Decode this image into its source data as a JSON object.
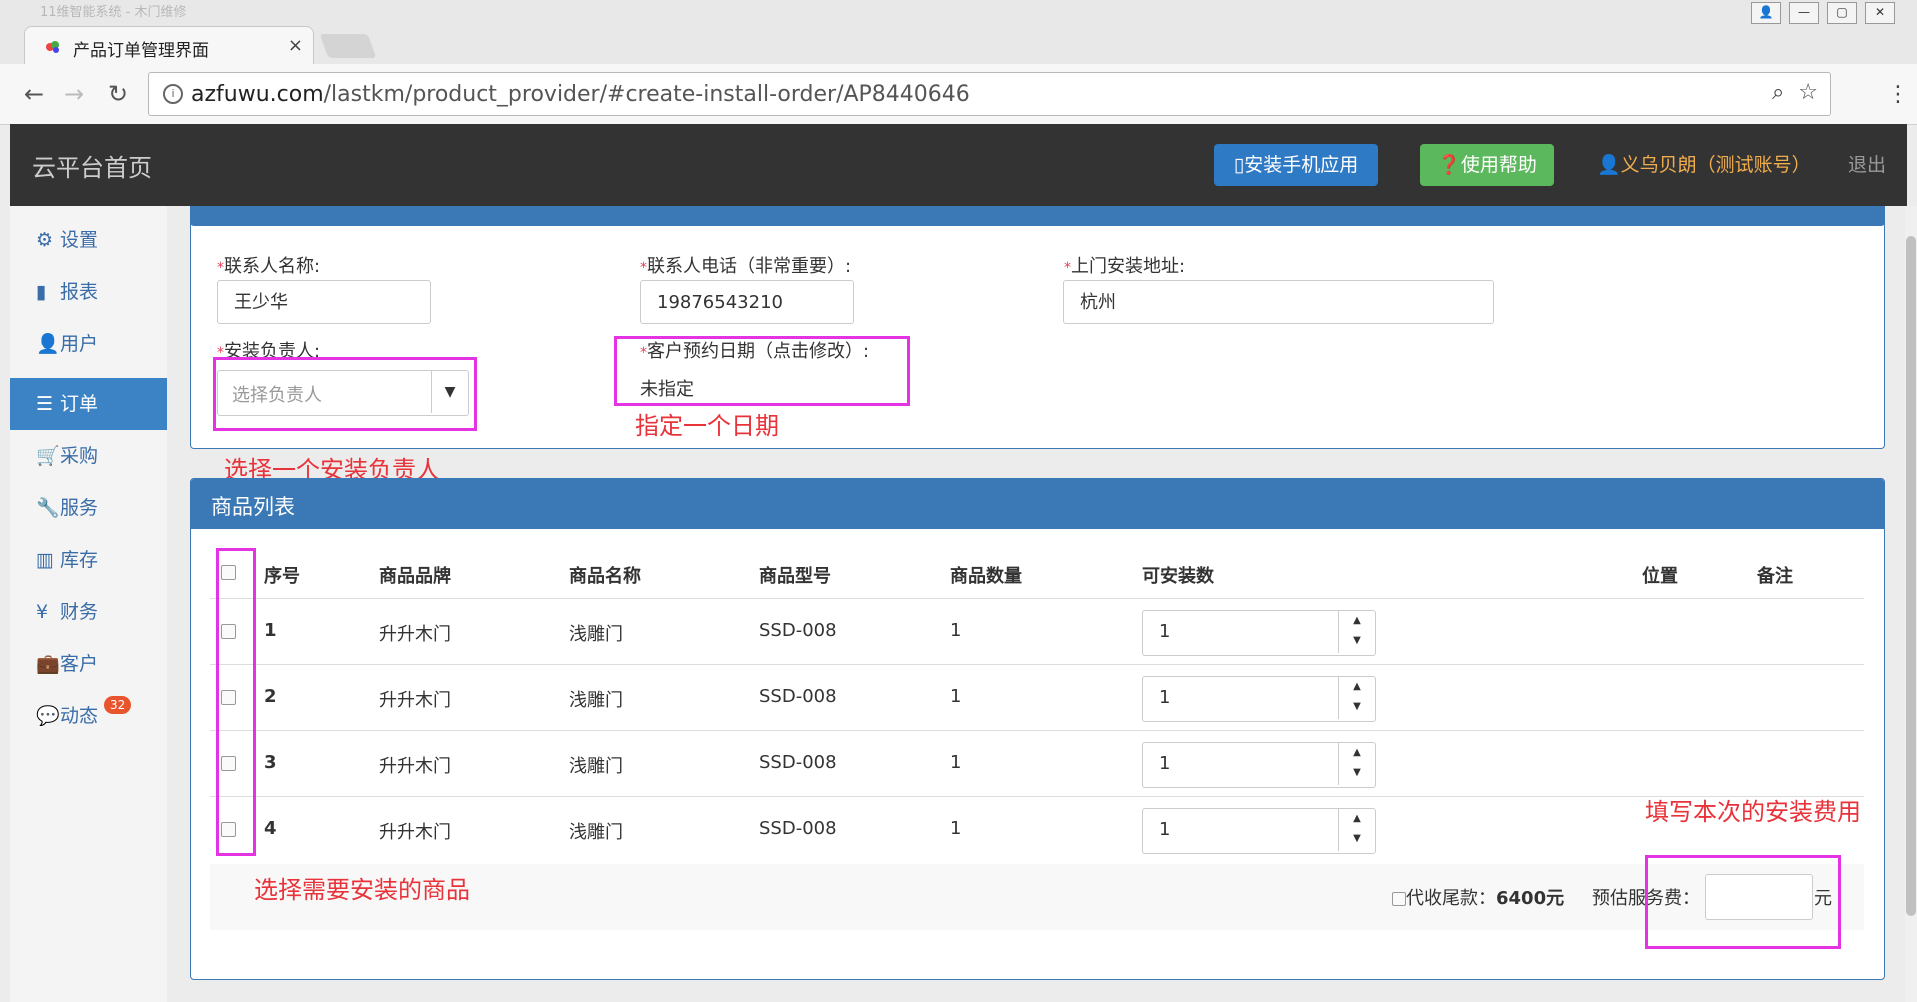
{
  "browser": {
    "ghost_tab_title": "11维智能系统 - 木门维修",
    "tab_title": "产品订单管理界面",
    "tab_close": "×",
    "url_domain": "azfuwu.com",
    "url_path": "/lastkm/product_provider/#create-install-order/AP8440646",
    "window_buttons": [
      "👤",
      "—",
      "▢",
      "✕"
    ]
  },
  "header": {
    "brand": "云平台首页",
    "install_app": "安装手机应用",
    "help": "使用帮助",
    "user": "义乌贝朗（测试账号）",
    "logout": "退出"
  },
  "sidebar": {
    "items": [
      {
        "icon": "gear-icon",
        "label": "设置"
      },
      {
        "icon": "chart-icon",
        "label": "报表"
      },
      {
        "icon": "user-icon",
        "label": "用户"
      },
      {
        "icon": "list-icon",
        "label": "订单"
      },
      {
        "icon": "cart-icon",
        "label": "采购"
      },
      {
        "icon": "wrench-icon",
        "label": "服务"
      },
      {
        "icon": "barcode-icon",
        "label": "库存"
      },
      {
        "icon": "yen-icon",
        "label": "财务"
      },
      {
        "icon": "briefcase-icon",
        "label": "客户"
      },
      {
        "icon": "comment-icon",
        "label": "动态"
      }
    ],
    "active_index": 3,
    "dynamic_badge": "32"
  },
  "service": {
    "contact_name_label": "联系人名称:",
    "contact_name_value": "王少华",
    "contact_phone_label": "联系人电话（非常重要）:",
    "contact_phone_value": "19876543210",
    "address_label": "上门安装地址:",
    "address_value": "杭州",
    "installer_label": "安装负责人:",
    "installer_placeholder": "选择负责人",
    "appointment_label": "客户预约日期（点击修改）:",
    "appointment_value": "未指定",
    "required_mark": "*"
  },
  "annotations": {
    "pick_date": "指定一个日期",
    "pick_installer": "选择一个安装负责人",
    "pick_products": "选择需要安装的商品",
    "fill_fee": "填写本次的安装费用"
  },
  "products": {
    "title": "商品列表",
    "columns": [
      "序号",
      "商品品牌",
      "商品名称",
      "商品型号",
      "商品数量",
      "可安装数",
      "位置",
      "备注"
    ],
    "rows": [
      {
        "no": "1",
        "brand": "升升木门",
        "name": "浅雕门",
        "model": "SSD-008",
        "qty": "1",
        "installable": "1"
      },
      {
        "no": "2",
        "brand": "升升木门",
        "name": "浅雕门",
        "model": "SSD-008",
        "qty": "1",
        "installable": "1"
      },
      {
        "no": "3",
        "brand": "升升木门",
        "name": "浅雕门",
        "model": "SSD-008",
        "qty": "1",
        "installable": "1"
      },
      {
        "no": "4",
        "brand": "升升木门",
        "name": "浅雕门",
        "model": "SSD-008",
        "qty": "1",
        "installable": "1"
      }
    ],
    "collect_label": "代收尾款：",
    "collect_amount": "6400元",
    "fee_label": "预估服务费：",
    "fee_value": "",
    "fee_unit": "元"
  }
}
